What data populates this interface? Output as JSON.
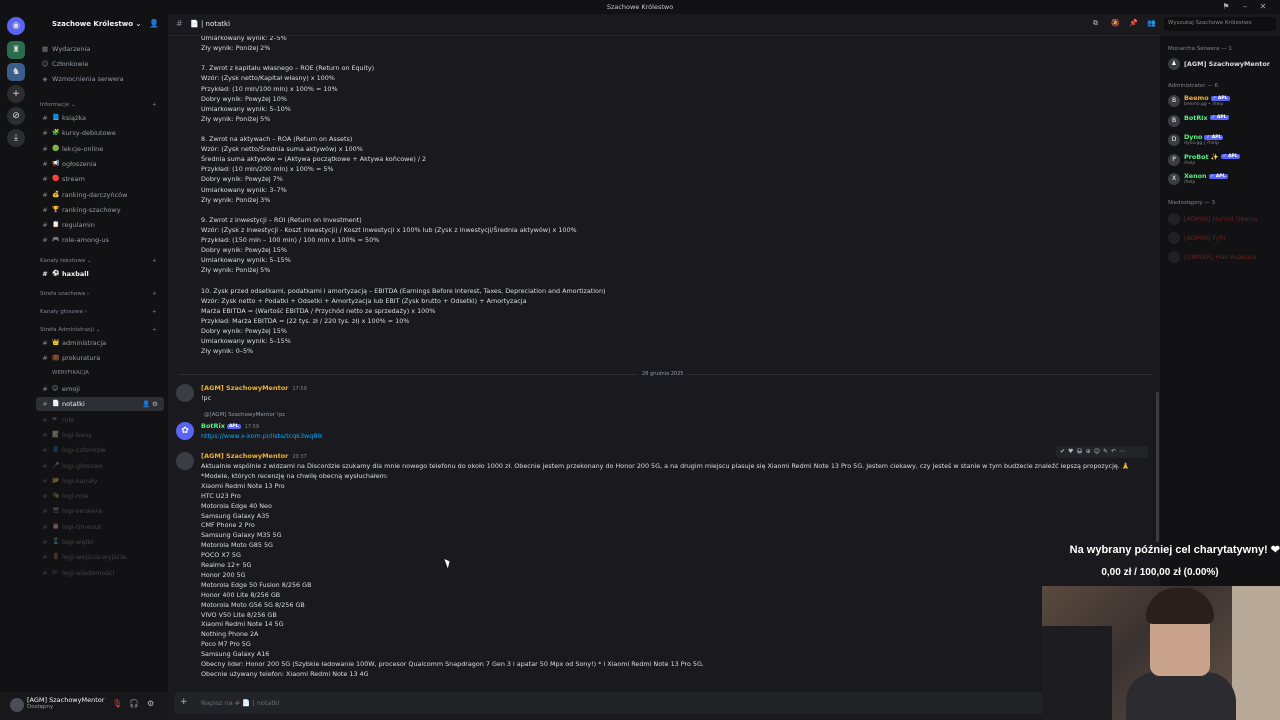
{
  "window": {
    "title": "Szachowe Królestwo"
  },
  "server": {
    "name": "Szachowe Królestwo ⌄"
  },
  "sidebar": {
    "top_items": [
      {
        "icon": "calendar-icon",
        "label": "Wydarzenia"
      },
      {
        "icon": "members-icon",
        "label": "Członkowie"
      },
      {
        "icon": "boost-icon",
        "label": "Wzmocnienia serwera"
      }
    ],
    "categories": {
      "informacje": "Informacje",
      "kanaly_tekstowe": "Kanały tekstowe",
      "strefa_szachowa": "Strefa szachowa",
      "kanaly_glosowe": "Kanały głosowe",
      "strefa_administracji": "Strefa Administracji",
      "weryfikacja": "WERYFIKACJA"
    },
    "info_channels": [
      {
        "emoji": "📘",
        "label": "książka"
      },
      {
        "emoji": "🧩",
        "label": "kursy-debiutowe"
      },
      {
        "emoji": "🟢",
        "label": "lekcje-online"
      },
      {
        "emoji": "📢",
        "label": "ogłoszenia"
      },
      {
        "emoji": "🔴",
        "label": "stream"
      },
      {
        "emoji": "💰",
        "label": "ranking-darczyńców"
      },
      {
        "emoji": "🏆",
        "label": "ranking-szachowy"
      },
      {
        "emoji": "📋",
        "label": "regulamin"
      },
      {
        "emoji": "🎮",
        "label": "role-among-us"
      }
    ],
    "text_channels": [
      {
        "emoji": "⚽",
        "label": "haxball"
      }
    ],
    "admin_channels": [
      {
        "emoji": "👑",
        "label": "administracja"
      },
      {
        "emoji": "💼",
        "label": "prokuratura"
      }
    ],
    "admin_channels_2": [
      {
        "emoji": "😊",
        "label": "emoji"
      },
      {
        "emoji": "📄",
        "label": "notatki"
      },
      {
        "emoji": "❤",
        "label": "role"
      },
      {
        "emoji": "📝",
        "label": "logi-bany"
      },
      {
        "emoji": "👤",
        "label": "logi-członków"
      },
      {
        "emoji": "🎤",
        "label": "logi-głosowe"
      },
      {
        "emoji": "📂",
        "label": "logi-kanały"
      },
      {
        "emoji": "🎭",
        "label": "logi-role"
      },
      {
        "emoji": "🖥",
        "label": "logi-serwera"
      },
      {
        "emoji": "⏰",
        "label": "logi-timeout"
      },
      {
        "emoji": "🧵",
        "label": "logi-wątki"
      },
      {
        "emoji": "🚪",
        "label": "logi-wejścia-wyjścia"
      },
      {
        "emoji": "✉",
        "label": "logi-wiadomości"
      }
    ]
  },
  "user": {
    "name": "[AGM] SzachowyMentor",
    "status": "Dostępny"
  },
  "chat": {
    "channel": "notatki",
    "date_divider": "28 grudnia 2025",
    "top_lines": [
      "Umiarkowany wynik: 2–5%",
      "Zły wynik: Poniżej 2%",
      "",
      "7. Zwrot z kapitału własnego – ROE (Return on Equity)",
      "Wzór: (Zysk netto/Kapitał własny) x 100%",
      "Przykład: (10 mln/100 mln) x 100% = 10%",
      "Dobry wynik: Powyżej 10%",
      "Umiarkowany wynik: 5–10%",
      "Zły wynik: Poniżej 5%",
      "",
      "8. Zwrot na aktywach – ROA (Return on Assets)",
      "Wzór: (Zysk netto/Średnia suma aktywów) x 100%",
      "Średnia suma aktywów = (Aktywa początkowe + Aktywa końcowe) / 2",
      "Przykład: (10 mln/200 mln) x 100% = 5%",
      "Dobry wynik: Powyżej 7%",
      "Umiarkowany wynik: 3–7%",
      "Zły wynik: Poniżej 3%",
      "",
      "9. Zwrot z inwestycji – ROI (Return on Investment)",
      "Wzór: (Zysk z inwestycji - Koszt inwestycji) / Koszt inwestycji x 100% lub (Zysk z inwestycji/Średnia aktywów) x 100%",
      "Przykład: (150 mln – 100 mln) / 100 mln x 100% = 50%",
      "Dobry wynik: Powyżej 15%",
      "Umiarkowany wynik: 5–15%",
      "Zły wynik: Poniżej 5%",
      "",
      "10. Zysk przed odsetkami, podatkami i amortyzacją – EBITDA (Earnings Before Interest, Taxes, Depreciation and Amortization)",
      "Wzór: Zysk netto + Podatki + Odsetki + Amortyzacja lub EBIT (Zysk brutto + Odsetki) + Amortyzacja",
      "Marża EBITDA = (Wartość EBITDA / Przychód netto ze sprzedaży) x 100%",
      "Przykład: Marża EBITDA = (22 tys. zł / 220 tys. zł) x 100% = 10%",
      "Dobry wynik: Powyżej 15%",
      "Umiarkowany wynik: 5–15%",
      "Zły wynik: 0–5%"
    ],
    "msg1": {
      "author": "[AGM] SzachowyMentor",
      "time": "17:59",
      "text": "!pc"
    },
    "msg2": {
      "reply": "@[AGM] SzachowyMentor !pc",
      "author": "BotRix",
      "badge": "APL",
      "time": "17:59",
      "link": "https://www.x-kom.pl/lista/tcqk3wq8lk"
    },
    "msg3": {
      "author": "[AGM] SzachowyMentor",
      "time": "20:37",
      "lines": [
        "Aktualnie wspólnie z widzami na Discordzie szukamy dla mnie nowego telefonu do około 1000 zł. Obecnie jestem przekonany do Honor 200 5G, a na drugim miejscu plasuje się Xiaomi Redmi Note 13 Pro 5G. Jestem ciekawy, czy jesteś w stanie w tym budżecie znaleźć lepszą propozycję. 🙏",
        "*Modele, których recenzję na chwilę obecną wysłuchałem:",
        "Xiaomi Redmi Note 13 Pro",
        "HTC U23 Pro",
        "Motorola Edge 40 Neo",
        "Samsung Galaxy A35",
        "CMF Phone 2 Pro",
        "Samsung Galaxy M35 5G",
        "Motorola Moto G85 5G",
        "POCO X7 5G",
        "Realme 12+ 5G",
        "Honor 200 5G",
        "Motorola Edge 50 Fusion 8/256 GB",
        "Honor 400 Lite 8/256 GB",
        "Motorola Moto G56 5G 8/256 GB",
        "VIVO V50 Lite 8/256 GB",
        "Xiaomi Redmi Note 14 5G",
        "Nothing Phone 2A",
        "Poco M7 Pro 5G",
        "Samsung Galaxy A16",
        "Obecny lider: Honor 200 5G (Szybkie ładowanie 100W, procesor Qualcomm Snapdragon 7 Gen 3 i apatar 50 Mpx od Sony!) * i Xiaomi Redmi Note 13 Pro 5G.",
        "Obecnie używany telefon: Xiaomi Redmi Note 13 4G"
      ]
    },
    "composer_placeholder": "Napisz na # 📄 | notatki"
  },
  "search": {
    "placeholder": "Wyszukaj Szachowe Królestwo"
  },
  "members": {
    "owner_header": "Monarcha Serwera — 1",
    "owner": {
      "name": "[AGM] SzachowyMentor",
      "color": "#f0b232"
    },
    "admin_header": "Administrator — 6",
    "admins": [
      {
        "name": "Beemo",
        "status": "beemo.gg • /help",
        "color": "#f0b232",
        "avatar": "B"
      },
      {
        "name": "BotRix",
        "status": "",
        "color": "#57f287",
        "avatar": "B"
      },
      {
        "name": "Dyno",
        "status": "dyno.gg | ?help",
        "color": "#57f287",
        "avatar": "D"
      },
      {
        "name": "ProBot ✨",
        "status": "/help",
        "color": "#57f287",
        "avatar": "P"
      },
      {
        "name": "Xenon",
        "status": "/help",
        "color": "#57f287",
        "avatar": "X"
      }
    ],
    "offline_header": "Niedostępny — 3",
    "offline": [
      {
        "name": "[ADMIN] Harold Obelus"
      },
      {
        "name": "[ADMIN] Fyfii"
      },
      {
        "name": "[OWNER] Hao Asakura"
      }
    ]
  },
  "overlay": {
    "donation_title": "Na wybrany później cel charytatywny! ❤",
    "donation_progress": "0,00 zł / 100,00 zł (0.00%)"
  }
}
